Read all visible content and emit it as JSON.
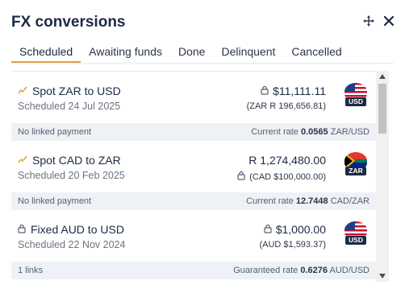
{
  "header": {
    "title": "FX conversions",
    "move_icon": "move-icon",
    "close_icon": "close-icon"
  },
  "tabs": [
    {
      "label": "Scheduled",
      "active": true
    },
    {
      "label": "Awaiting funds",
      "active": false
    },
    {
      "label": "Done",
      "active": false
    },
    {
      "label": "Delinquent",
      "active": false
    },
    {
      "label": "Cancelled",
      "active": false
    }
  ],
  "conversions": [
    {
      "pair": "Spot ZAR to USD",
      "pair_icon": "trend-icon",
      "scheduled": "Scheduled 24 Jul 2025",
      "amount": "$11,111.11",
      "amount_locked": true,
      "sub_amount": "(ZAR R 196,656.81)",
      "sub_locked": false,
      "currency": "USD",
      "flag": "us-flag-icon",
      "foot_left": "No linked payment",
      "rate_label": "Current rate",
      "rate_value": "0.0565",
      "rate_pair": "ZAR/USD"
    },
    {
      "pair": "Spot CAD to ZAR",
      "pair_icon": "trend-icon",
      "scheduled": "Scheduled 20 Feb 2025",
      "amount": "R 1,274,480.00",
      "amount_locked": false,
      "sub_amount": "(CAD $100,000.00)",
      "sub_locked": true,
      "currency": "ZAR",
      "flag": "za-flag-icon",
      "foot_left": "No linked payment",
      "rate_label": "Current rate",
      "rate_value": "12.7448",
      "rate_pair": "CAD/ZAR"
    },
    {
      "pair": "Fixed AUD to USD",
      "pair_icon": "lock-icon",
      "scheduled": "Scheduled 22 Nov 2024",
      "amount": "$1,000.00",
      "amount_locked": true,
      "sub_amount": "(AUD $1,593.37)",
      "sub_locked": false,
      "currency": "USD",
      "flag": "us-flag-icon",
      "foot_left": "1 links",
      "rate_label": "Guaranteed rate",
      "rate_value": "0.6276",
      "rate_pair": "AUD/USD"
    }
  ],
  "colors": {
    "accent_tab": "#e2a048",
    "title": "#1b2a44",
    "trend": "#e2a048",
    "footer_bg": "#eef1f5"
  }
}
